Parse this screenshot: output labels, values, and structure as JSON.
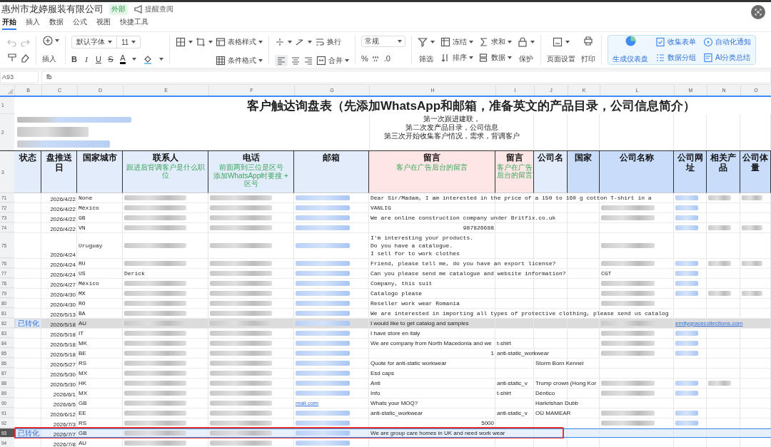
{
  "doc": {
    "title": "惠州市龙婷服装有限公司",
    "badge": "外部",
    "remind": "提醒查阅"
  },
  "tabs": [
    {
      "label": "开始",
      "selected": true
    },
    {
      "label": "插入",
      "selected": false
    },
    {
      "label": "数据",
      "selected": false
    },
    {
      "label": "公式",
      "selected": false
    },
    {
      "label": "视图",
      "selected": false
    },
    {
      "label": "快捷工具",
      "selected": false
    }
  ],
  "toolbar": {
    "insert": "插入",
    "font": "默认字体",
    "size": "11",
    "table_style": "表格样式",
    "cond_format": "条件格式",
    "wrap": "换行",
    "merge": "合并",
    "number_format": "常规",
    "filter": "筛选",
    "freeze": "冻结",
    "sort": "排序",
    "sum": "求和",
    "data": "数据",
    "protect": "保护",
    "page_setup": "页面设置",
    "print": "打印",
    "dashboard": "生成仪表盘",
    "collect_form": "收集表单",
    "data_group": "数据分组",
    "auto_notify": "自动化通知",
    "ai_summary": "AI分类总结",
    "format": [
      {
        "label": "B",
        "kind": "bold"
      },
      {
        "label": "I",
        "kind": "italic"
      },
      {
        "label": "U",
        "kind": "underline"
      },
      {
        "label": "S",
        "kind": "strike"
      },
      {
        "label": "A",
        "kind": "color"
      }
    ],
    "percent": "%",
    "decimal": ".0"
  },
  "formula_bar": {
    "cell": "A93",
    "value": "fb"
  },
  "columns": [
    "B",
    "C",
    "D",
    "E",
    "F",
    "G",
    "H",
    "I",
    "J",
    "K",
    "L",
    "M",
    "N",
    "O"
  ],
  "sheet": {
    "title": "客户触达询盘表（先添加WhatsApp和邮箱，准备英文的产品目录，公司信息简介）",
    "notes": [
      "第一次跟进建联，",
      "第二次发产品目录，公司信息",
      "第三次开始收集客户情况，需求，背调客户"
    ],
    "header_rows": [
      "1",
      "2",
      "3"
    ],
    "headers": [
      {
        "label": "状态",
        "color": "#e3ecfb"
      },
      {
        "label": "盘推送日",
        "color": "#e3ecfb"
      },
      {
        "label": "国家城市",
        "color": "#e3ecfb"
      },
      {
        "label": "联系人",
        "color": "#e3ecfb",
        "hints": [
          "跟进后背调客户是什么职位"
        ]
      },
      {
        "label": "电话",
        "color": "#e3ecfb",
        "hints": [
          "前面两到三位是区号",
          "添加WhatsApp时要搜 + 区号"
        ]
      },
      {
        "label": "邮箱",
        "color": "#e3ecfb"
      },
      {
        "label": "留言",
        "color": "#fde6e5",
        "hints": [
          "客户在广告后台的留言"
        ]
      },
      {
        "label": "留言",
        "color": "#fde6e5",
        "hints": [
          "客户在广告后台的留言"
        ]
      },
      {
        "label": "公司名",
        "color": "#e3ecfb"
      },
      {
        "label": "国家",
        "color": "#c9dcfa"
      },
      {
        "label": "公司名称",
        "color": "#c9dcfa"
      },
      {
        "label": "公司网址",
        "color": "#c9dcfa"
      },
      {
        "label": "相关产品",
        "color": "#c9dcfa"
      },
      {
        "label": "公司体量",
        "color": "#c9dcfa"
      }
    ],
    "rows": [
      {
        "num": "71",
        "status": "",
        "date": "2026/4/22",
        "country": "None",
        "selected": false,
        "highlighted": false,
        "annotated": false,
        "cells": [
          {
            "kind": "blurred"
          },
          {
            "kind": "blurred"
          },
          {
            "kind": "blurred"
          },
          {
            "kind": "text",
            "text": "Dear Sir/Madam, I am interested in the price of a 150 to 160 g cotton T-shirt in a"
          },
          {
            "kind": "blank"
          },
          {
            "kind": "blank"
          },
          {
            "kind": "blank"
          },
          {
            "kind": "blank"
          },
          {
            "kind": "blurred"
          },
          {
            "kind": "blurred"
          },
          {
            "kind": "blurred"
          }
        ]
      },
      {
        "num": "72",
        "status": "",
        "date": "2026/4/22",
        "country": "México",
        "selected": false,
        "highlighted": false,
        "annotated": false,
        "cells": [
          {
            "kind": "blurred"
          },
          {
            "kind": "blurred"
          },
          {
            "kind": "blurred"
          },
          {
            "kind": "text",
            "text": "VANLIG"
          },
          {
            "kind": "blank"
          },
          {
            "kind": "blank"
          },
          {
            "kind": "blank"
          },
          {
            "kind": "blurred"
          },
          {
            "kind": "blurred"
          },
          {
            "kind": "blank"
          },
          {
            "kind": "blank"
          }
        ]
      },
      {
        "num": "73",
        "status": "",
        "date": "2026/4/22",
        "country": "GB",
        "selected": false,
        "highlighted": false,
        "annotated": false,
        "cells": [
          {
            "kind": "blurred"
          },
          {
            "kind": "blurred"
          },
          {
            "kind": "blurred"
          },
          {
            "kind": "text",
            "text": "We are online construction company under Britfix.co.uk"
          },
          {
            "kind": "blank"
          },
          {
            "kind": "blank"
          },
          {
            "kind": "blank"
          },
          {
            "kind": "blurred"
          },
          {
            "kind": "blurred"
          },
          {
            "kind": "blank"
          },
          {
            "kind": "blank"
          }
        ]
      },
      {
        "num": "74",
        "status": "",
        "date": "2026/4/22",
        "country": "VN",
        "selected": false,
        "highlighted": false,
        "annotated": false,
        "cells": [
          {
            "kind": "blurred"
          },
          {
            "kind": "blurred"
          },
          {
            "kind": "blurred"
          },
          {
            "kind": "number",
            "text": "987826688"
          },
          {
            "kind": "blank"
          },
          {
            "kind": "blank"
          },
          {
            "kind": "blank"
          },
          {
            "kind": "blank"
          },
          {
            "kind": "blurred"
          },
          {
            "kind": "blurred"
          },
          {
            "kind": "blurred"
          }
        ]
      },
      {
        "num": "75",
        "status": "",
        "date": "2026/4/24",
        "country": "Uruguay",
        "selected": false,
        "highlighted": false,
        "annotated": false,
        "cells": [
          {
            "kind": "blurred"
          },
          {
            "kind": "blurred"
          },
          {
            "kind": "blurred"
          },
          {
            "kind": "text",
            "text": "I'm interesting your products.\nDo you have a catalogue.\nI sell for to work clothes"
          },
          {
            "kind": "blank"
          },
          {
            "kind": "blank"
          },
          {
            "kind": "blank"
          },
          {
            "kind": "blurred"
          },
          {
            "kind": "blank"
          },
          {
            "kind": "blank"
          },
          {
            "kind": "blank"
          }
        ]
      },
      {
        "num": "76",
        "status": "",
        "date": "2026/4/24",
        "country": "RU",
        "selected": false,
        "highlighted": false,
        "annotated": false,
        "cells": [
          {
            "kind": "blurred"
          },
          {
            "kind": "blurred"
          },
          {
            "kind": "blurred"
          },
          {
            "kind": "text",
            "text": "Friend, please tell me, do you have an export license?"
          },
          {
            "kind": "blank"
          },
          {
            "kind": "blank"
          },
          {
            "kind": "blank"
          },
          {
            "kind": "blurred"
          },
          {
            "kind": "blurred"
          },
          {
            "kind": "blurred"
          },
          {
            "kind": "blurred"
          }
        ]
      },
      {
        "num": "77",
        "status": "",
        "date": "2026/4/24",
        "country": "US",
        "selected": false,
        "highlighted": false,
        "annotated": false,
        "cells": [
          {
            "kind": "text",
            "text": "Derick"
          },
          {
            "kind": "blurred"
          },
          {
            "kind": "blurred"
          },
          {
            "kind": "text",
            "text": "Can you please send me catalogue and website information?"
          },
          {
            "kind": "blank"
          },
          {
            "kind": "blank"
          },
          {
            "kind": "blank"
          },
          {
            "kind": "text",
            "text": "CGT"
          },
          {
            "kind": "blurred"
          },
          {
            "kind": "blank"
          },
          {
            "kind": "blank"
          }
        ]
      },
      {
        "num": "78",
        "status": "",
        "date": "2026/4/27",
        "country": "México",
        "selected": false,
        "highlighted": false,
        "annotated": false,
        "cells": [
          {
            "kind": "blurred"
          },
          {
            "kind": "blurred"
          },
          {
            "kind": "blurred"
          },
          {
            "kind": "text",
            "text": "Company, this suit"
          },
          {
            "kind": "blank"
          },
          {
            "kind": "blank"
          },
          {
            "kind": "blank"
          },
          {
            "kind": "blurred"
          },
          {
            "kind": "blurred"
          },
          {
            "kind": "blank"
          },
          {
            "kind": "blank"
          }
        ]
      },
      {
        "num": "79",
        "status": "",
        "date": "2026/4/30",
        "country": "MX",
        "selected": false,
        "highlighted": false,
        "annotated": false,
        "cells": [
          {
            "kind": "blurred"
          },
          {
            "kind": "blurred"
          },
          {
            "kind": "blurred"
          },
          {
            "kind": "text",
            "text": "Catalogo please"
          },
          {
            "kind": "blank"
          },
          {
            "kind": "blank"
          },
          {
            "kind": "blank"
          },
          {
            "kind": "blurred"
          },
          {
            "kind": "blurred"
          },
          {
            "kind": "blurred"
          },
          {
            "kind": "blurred"
          }
        ]
      },
      {
        "num": "80",
        "status": "",
        "date": "2026/4/30",
        "country": "RO",
        "selected": false,
        "highlighted": false,
        "annotated": false,
        "cells": [
          {
            "kind": "blurred"
          },
          {
            "kind": "blurred"
          },
          {
            "kind": "blurred"
          },
          {
            "kind": "text",
            "text": "Reseller work wear Romania"
          },
          {
            "kind": "blank"
          },
          {
            "kind": "blank"
          },
          {
            "kind": "blank"
          },
          {
            "kind": "blurred"
          },
          {
            "kind": "blank"
          },
          {
            "kind": "blank"
          },
          {
            "kind": "blank"
          }
        ]
      },
      {
        "num": "81",
        "status": "",
        "date": "2026/5/13",
        "country": "BA",
        "selected": false,
        "highlighted": false,
        "annotated": false,
        "cells": [
          {
            "kind": "blurred"
          },
          {
            "kind": "blurred"
          },
          {
            "kind": "blurred"
          },
          {
            "kind": "text",
            "text": "We are interested in importing all types of protective clothing, please send us catalog"
          },
          {
            "kind": "blank"
          },
          {
            "kind": "blank"
          },
          {
            "kind": "blank"
          },
          {
            "kind": "blank"
          },
          {
            "kind": "blank"
          },
          {
            "kind": "blank"
          },
          {
            "kind": "blank"
          }
        ]
      },
      {
        "num": "82",
        "status": "已转化",
        "date": "2026/5/18",
        "country": "AU",
        "selected": false,
        "highlighted": true,
        "annotated": false,
        "cells": [
          {
            "kind": "blurred"
          },
          {
            "kind": "blurred"
          },
          {
            "kind": "blurred"
          },
          {
            "kind": "text",
            "text": "I would like to get catalog and samples"
          },
          {
            "kind": "blank"
          },
          {
            "kind": "blank"
          },
          {
            "kind": "blank"
          },
          {
            "kind": "blurred"
          },
          {
            "kind": "link",
            "text": "ernitygracecollections.com"
          },
          {
            "kind": "blank"
          },
          {
            "kind": "blank"
          }
        ]
      },
      {
        "num": "83",
        "status": "",
        "date": "2026/5/18",
        "country": "IT",
        "selected": false,
        "highlighted": false,
        "annotated": false,
        "cells": [
          {
            "kind": "blurred"
          },
          {
            "kind": "blurred"
          },
          {
            "kind": "blurred"
          },
          {
            "kind": "text",
            "text": "I have store en italy"
          },
          {
            "kind": "blank"
          },
          {
            "kind": "blank"
          },
          {
            "kind": "blank"
          },
          {
            "kind": "blurred"
          },
          {
            "kind": "blurred"
          },
          {
            "kind": "blank"
          },
          {
            "kind": "blank"
          }
        ]
      },
      {
        "num": "84",
        "status": "",
        "date": "2026/5/18",
        "country": "MK",
        "selected": false,
        "highlighted": false,
        "annotated": false,
        "cells": [
          {
            "kind": "blurred"
          },
          {
            "kind": "blurred"
          },
          {
            "kind": "blurred"
          },
          {
            "kind": "text",
            "text": "We are company from North Macedonia and we"
          },
          {
            "kind": "text",
            "text": "t-shirt"
          },
          {
            "kind": "blank"
          },
          {
            "kind": "blank"
          },
          {
            "kind": "blurred"
          },
          {
            "kind": "blurred"
          },
          {
            "kind": "blank"
          },
          {
            "kind": "blank"
          }
        ]
      },
      {
        "num": "85",
        "status": "",
        "date": "2026/5/18",
        "country": "BE",
        "selected": false,
        "highlighted": false,
        "annotated": false,
        "cells": [
          {
            "kind": "blurred"
          },
          {
            "kind": "blurred"
          },
          {
            "kind": "blurred"
          },
          {
            "kind": "number",
            "text": "1"
          },
          {
            "kind": "text",
            "text": "anti-static_workwear"
          },
          {
            "kind": "blank"
          },
          {
            "kind": "blank"
          },
          {
            "kind": "blurred"
          },
          {
            "kind": "blurred"
          },
          {
            "kind": "blank"
          },
          {
            "kind": "blank"
          }
        ]
      },
      {
        "num": "86",
        "status": "",
        "date": "2026/5/27",
        "country": "RS",
        "selected": false,
        "highlighted": false,
        "annotated": false,
        "cells": [
          {
            "kind": "blurred"
          },
          {
            "kind": "blurred"
          },
          {
            "kind": "blurred"
          },
          {
            "kind": "text",
            "text": "Quote for anti-static workwear"
          },
          {
            "kind": "blank"
          },
          {
            "kind": "text",
            "text": "Storm Born Kennel"
          },
          {
            "kind": "blank"
          },
          {
            "kind": "blank"
          },
          {
            "kind": "blank"
          },
          {
            "kind": "blank"
          },
          {
            "kind": "blank"
          }
        ]
      },
      {
        "num": "87",
        "status": "",
        "date": "2026/5/30",
        "country": "MX",
        "selected": false,
        "highlighted": false,
        "annotated": false,
        "cells": [
          {
            "kind": "blurred"
          },
          {
            "kind": "blurred"
          },
          {
            "kind": "blurred"
          },
          {
            "kind": "text",
            "text": "Esd caps"
          },
          {
            "kind": "blank"
          },
          {
            "kind": "blank"
          },
          {
            "kind": "blank"
          },
          {
            "kind": "blank"
          },
          {
            "kind": "blank"
          },
          {
            "kind": "blank"
          },
          {
            "kind": "blank"
          }
        ]
      },
      {
        "num": "88",
        "status": "",
        "date": "2026/5/30",
        "country": "HK",
        "selected": false,
        "highlighted": false,
        "annotated": false,
        "cells": [
          {
            "kind": "blurred"
          },
          {
            "kind": "blurred"
          },
          {
            "kind": "blurred"
          },
          {
            "kind": "text",
            "text": "Anti"
          },
          {
            "kind": "text",
            "text": "anti-static_v"
          },
          {
            "kind": "text",
            "text": "Trump crown (Hong Kor"
          },
          {
            "kind": "blank"
          },
          {
            "kind": "blurred"
          },
          {
            "kind": "blurred"
          },
          {
            "kind": "blurred"
          },
          {
            "kind": "blank"
          }
        ]
      },
      {
        "num": "89",
        "status": "",
        "date": "2026/6/1",
        "country": "MX",
        "selected": false,
        "highlighted": false,
        "annotated": false,
        "cells": [
          {
            "kind": "blurred"
          },
          {
            "kind": "blurred"
          },
          {
            "kind": "blurred"
          },
          {
            "kind": "text",
            "text": "Info"
          },
          {
            "kind": "text",
            "text": "t-shirt"
          },
          {
            "kind": "text",
            "text": "Déntico"
          },
          {
            "kind": "blank"
          },
          {
            "kind": "blurred"
          },
          {
            "kind": "blurred"
          },
          {
            "kind": "blank"
          },
          {
            "kind": "blank"
          }
        ]
      },
      {
        "num": "90",
        "status": "",
        "date": "2026/6/5",
        "country": "GB",
        "selected": false,
        "highlighted": false,
        "annotated": false,
        "cells": [
          {
            "kind": "blurred"
          },
          {
            "kind": "blurred"
          },
          {
            "kind": "link",
            "text": "mail.com"
          },
          {
            "kind": "text",
            "text": "Whats your MOQ?"
          },
          {
            "kind": "blank"
          },
          {
            "kind": "text",
            "text": "Harkrishan Dubb"
          },
          {
            "kind": "blank"
          },
          {
            "kind": "blank"
          },
          {
            "kind": "blank"
          },
          {
            "kind": "blank"
          },
          {
            "kind": "blank"
          }
        ]
      },
      {
        "num": "91",
        "status": "",
        "date": "2026/6/12",
        "country": "EE",
        "selected": false,
        "highlighted": false,
        "annotated": false,
        "cells": [
          {
            "kind": "blurred"
          },
          {
            "kind": "blurred"
          },
          {
            "kind": "blurred"
          },
          {
            "kind": "text",
            "text": "anti-static_workwear"
          },
          {
            "kind": "text",
            "text": "anti-static_v"
          },
          {
            "kind": "text",
            "text": "OÜ MAMEAR"
          },
          {
            "kind": "blank"
          },
          {
            "kind": "blurred"
          },
          {
            "kind": "blurred"
          },
          {
            "kind": "blank"
          },
          {
            "kind": "blank"
          }
        ]
      },
      {
        "num": "92",
        "status": "",
        "date": "2026/7/3",
        "country": "RS",
        "selected": false,
        "highlighted": false,
        "annotated": false,
        "cells": [
          {
            "kind": "blurred"
          },
          {
            "kind": "blurred"
          },
          {
            "kind": "blurred"
          },
          {
            "kind": "number",
            "text": "5000"
          },
          {
            "kind": "blank"
          },
          {
            "kind": "blank"
          },
          {
            "kind": "blank"
          },
          {
            "kind": "blurred"
          },
          {
            "kind": "blurred"
          },
          {
            "kind": "blank"
          },
          {
            "kind": "blank"
          }
        ]
      },
      {
        "num": "93",
        "status": "已转化",
        "date": "2026/7/7",
        "country": "GB",
        "selected": true,
        "highlighted": false,
        "annotated": true,
        "cells": [
          {
            "kind": "blurred"
          },
          {
            "kind": "blurred"
          },
          {
            "kind": "blurred"
          },
          {
            "kind": "text",
            "text": "We are group care homes in UK and need work wear"
          },
          {
            "kind": "blank"
          },
          {
            "kind": "blank"
          },
          {
            "kind": "blank"
          },
          {
            "kind": "blank"
          },
          {
            "kind": "blank"
          },
          {
            "kind": "blank"
          },
          {
            "kind": "blank"
          }
        ]
      },
      {
        "num": "94",
        "status": "",
        "date": "2026/7/8",
        "country": "AU",
        "selected": false,
        "highlighted": false,
        "annotated": false,
        "cells": [
          {
            "kind": "blurred"
          },
          {
            "kind": "blurred"
          },
          {
            "kind": "blurred"
          },
          {
            "kind": "blank"
          },
          {
            "kind": "blank"
          },
          {
            "kind": "blank"
          },
          {
            "kind": "blank"
          },
          {
            "kind": "blank"
          },
          {
            "kind": "blank"
          },
          {
            "kind": "blank"
          },
          {
            "kind": "blank"
          }
        ]
      }
    ]
  }
}
